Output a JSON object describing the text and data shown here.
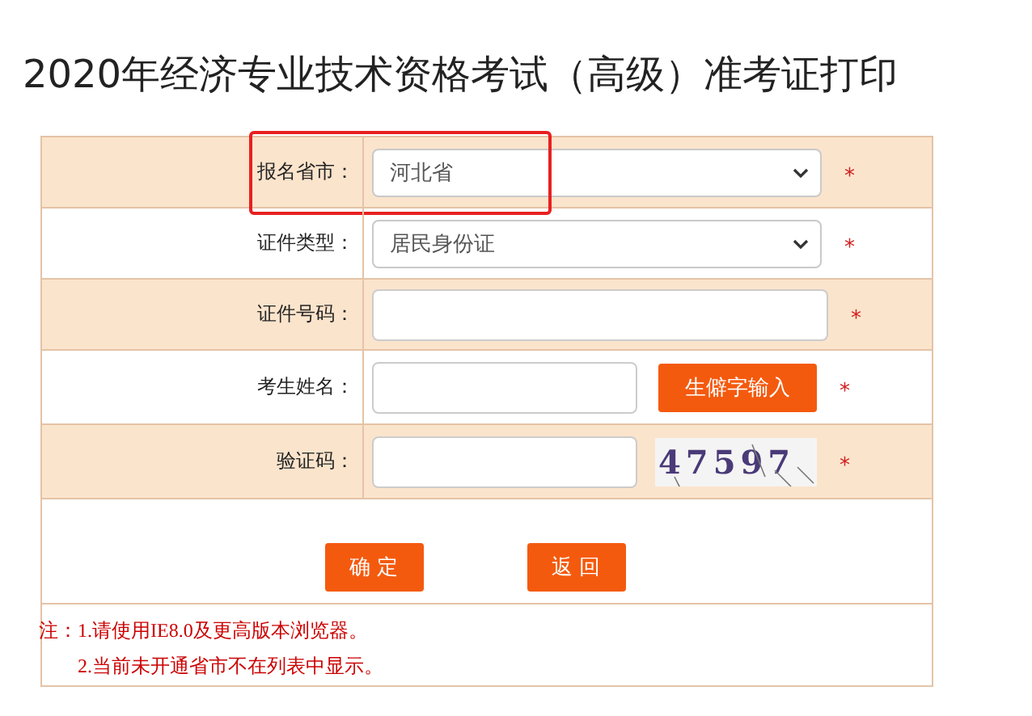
{
  "title": "2020年经济专业技术资格考试（高级）准考证打印",
  "fields": [
    {
      "label": "报名省市：",
      "kind": "select",
      "value": "河北省",
      "mark": "*",
      "highlighted": true
    },
    {
      "label": "证件类型：",
      "kind": "select",
      "value": "居民身份证",
      "mark": "*",
      "highlighted": false
    },
    {
      "label": "证件号码：",
      "kind": "input",
      "mark": "*",
      "highlighted": false
    },
    {
      "label": "考生姓名：",
      "kind": "input_button",
      "button": "生僻字输入",
      "mark": "*",
      "highlighted": false
    },
    {
      "label": "验证码：",
      "kind": "input_captcha",
      "captcha": "47597",
      "mark": "*",
      "highlighted": false
    }
  ],
  "buttons": [
    "确 定",
    "返 回"
  ],
  "notes": [
    "注：1.请使用IE8.0及更高版本浏览器。",
    "2.当前未开通省市不在列表中显示。"
  ]
}
